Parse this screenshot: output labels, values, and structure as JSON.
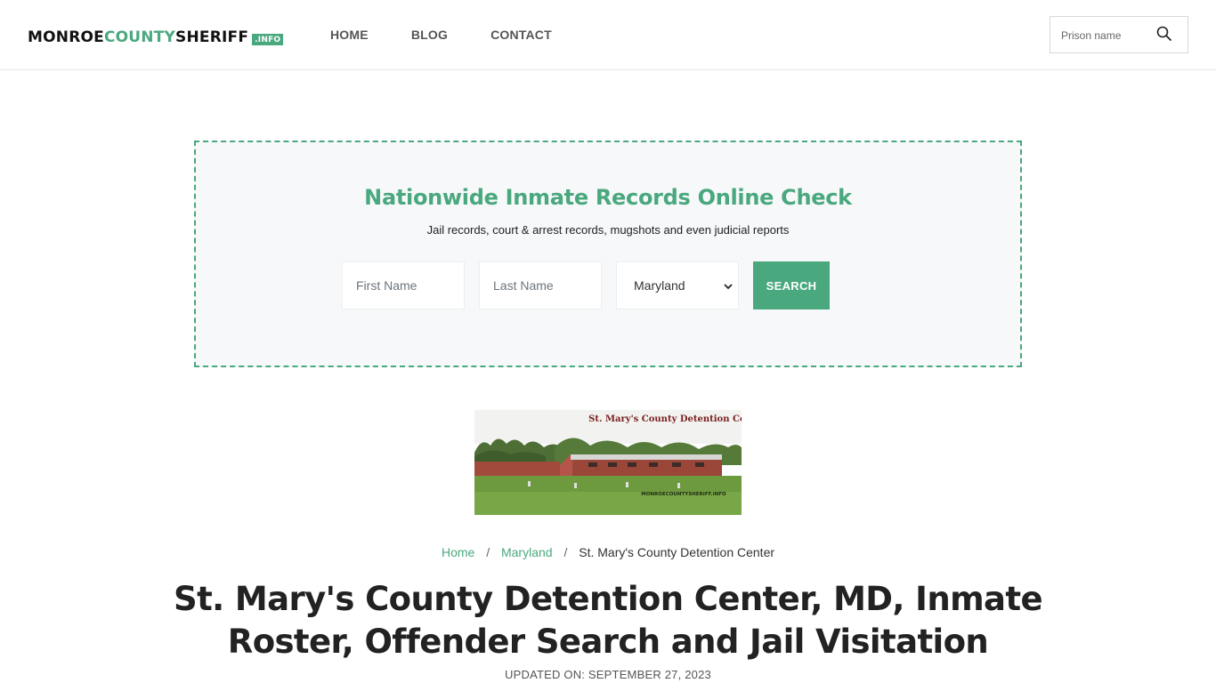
{
  "header": {
    "logo": {
      "part1": "MONROE",
      "part2": "COUNTY",
      "part3": "SHERIFF",
      "tld": ".INFO"
    },
    "nav": [
      "HOME",
      "BLOG",
      "CONTACT"
    ],
    "search": {
      "placeholder": "Prison name",
      "icon": "search-icon"
    }
  },
  "search_box": {
    "title": "Nationwide Inmate Records Online Check",
    "subtitle": "Jail records, court & arrest records, mugshots and even judicial reports",
    "first_name_placeholder": "First Name",
    "last_name_placeholder": "Last Name",
    "state_selected": "Maryland",
    "button_label": "SEARCH"
  },
  "photo": {
    "caption": "St. Mary's County Detention Center",
    "watermark": "MONROECOUNTYSHERIFF.INFO"
  },
  "breadcrumb": {
    "home": "Home",
    "state": "Maryland",
    "current": "St. Mary's County Detention Center",
    "separator": "/"
  },
  "page": {
    "title": "St. Mary's County Detention Center, MD, Inmate Roster, Offender Search and Jail Visitation",
    "updated": "UPDATED ON: SEPTEMBER 27, 2023"
  },
  "colors": {
    "accent": "#4aa87e",
    "text": "#222222",
    "nav": "#555555"
  }
}
